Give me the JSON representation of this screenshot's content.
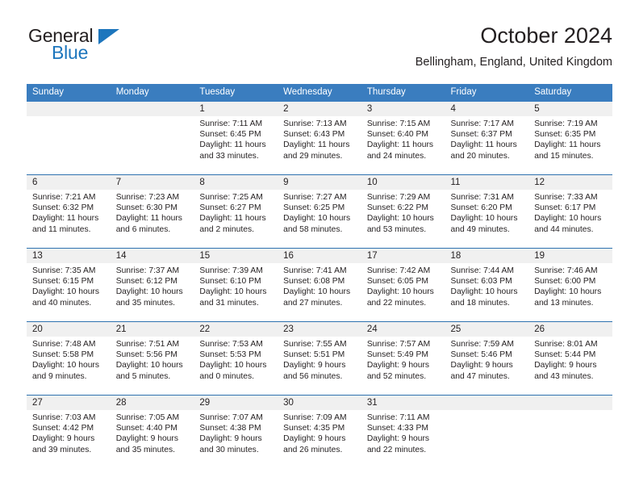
{
  "brand": {
    "name_part1": "General",
    "name_part2": "Blue",
    "colors": {
      "dark": "#231f20",
      "blue": "#1d76bd"
    }
  },
  "header": {
    "title": "October 2024",
    "subtitle": "Bellingham, England, United Kingdom"
  },
  "theme": {
    "header_row_bg": "#3a7dbf",
    "header_row_text": "#ffffff",
    "date_band_bg": "#f0f0f0",
    "row_separator": "#2f72b0",
    "cell_bg": "#ffffff",
    "text": "#231f20"
  },
  "weekday_headers": [
    "Sunday",
    "Monday",
    "Tuesday",
    "Wednesday",
    "Thursday",
    "Friday",
    "Saturday"
  ],
  "weeks": [
    [
      {
        "day": "",
        "empty": true
      },
      {
        "day": "",
        "empty": true
      },
      {
        "day": "1",
        "sunrise": "Sunrise: 7:11 AM",
        "sunset": "Sunset: 6:45 PM",
        "daylight_line1": "Daylight: 11 hours",
        "daylight_line2": "and 33 minutes."
      },
      {
        "day": "2",
        "sunrise": "Sunrise: 7:13 AM",
        "sunset": "Sunset: 6:43 PM",
        "daylight_line1": "Daylight: 11 hours",
        "daylight_line2": "and 29 minutes."
      },
      {
        "day": "3",
        "sunrise": "Sunrise: 7:15 AM",
        "sunset": "Sunset: 6:40 PM",
        "daylight_line1": "Daylight: 11 hours",
        "daylight_line2": "and 24 minutes."
      },
      {
        "day": "4",
        "sunrise": "Sunrise: 7:17 AM",
        "sunset": "Sunset: 6:37 PM",
        "daylight_line1": "Daylight: 11 hours",
        "daylight_line2": "and 20 minutes."
      },
      {
        "day": "5",
        "sunrise": "Sunrise: 7:19 AM",
        "sunset": "Sunset: 6:35 PM",
        "daylight_line1": "Daylight: 11 hours",
        "daylight_line2": "and 15 minutes."
      }
    ],
    [
      {
        "day": "6",
        "sunrise": "Sunrise: 7:21 AM",
        "sunset": "Sunset: 6:32 PM",
        "daylight_line1": "Daylight: 11 hours",
        "daylight_line2": "and 11 minutes."
      },
      {
        "day": "7",
        "sunrise": "Sunrise: 7:23 AM",
        "sunset": "Sunset: 6:30 PM",
        "daylight_line1": "Daylight: 11 hours",
        "daylight_line2": "and 6 minutes."
      },
      {
        "day": "8",
        "sunrise": "Sunrise: 7:25 AM",
        "sunset": "Sunset: 6:27 PM",
        "daylight_line1": "Daylight: 11 hours",
        "daylight_line2": "and 2 minutes."
      },
      {
        "day": "9",
        "sunrise": "Sunrise: 7:27 AM",
        "sunset": "Sunset: 6:25 PM",
        "daylight_line1": "Daylight: 10 hours",
        "daylight_line2": "and 58 minutes."
      },
      {
        "day": "10",
        "sunrise": "Sunrise: 7:29 AM",
        "sunset": "Sunset: 6:22 PM",
        "daylight_line1": "Daylight: 10 hours",
        "daylight_line2": "and 53 minutes."
      },
      {
        "day": "11",
        "sunrise": "Sunrise: 7:31 AM",
        "sunset": "Sunset: 6:20 PM",
        "daylight_line1": "Daylight: 10 hours",
        "daylight_line2": "and 49 minutes."
      },
      {
        "day": "12",
        "sunrise": "Sunrise: 7:33 AM",
        "sunset": "Sunset: 6:17 PM",
        "daylight_line1": "Daylight: 10 hours",
        "daylight_line2": "and 44 minutes."
      }
    ],
    [
      {
        "day": "13",
        "sunrise": "Sunrise: 7:35 AM",
        "sunset": "Sunset: 6:15 PM",
        "daylight_line1": "Daylight: 10 hours",
        "daylight_line2": "and 40 minutes."
      },
      {
        "day": "14",
        "sunrise": "Sunrise: 7:37 AM",
        "sunset": "Sunset: 6:12 PM",
        "daylight_line1": "Daylight: 10 hours",
        "daylight_line2": "and 35 minutes."
      },
      {
        "day": "15",
        "sunrise": "Sunrise: 7:39 AM",
        "sunset": "Sunset: 6:10 PM",
        "daylight_line1": "Daylight: 10 hours",
        "daylight_line2": "and 31 minutes."
      },
      {
        "day": "16",
        "sunrise": "Sunrise: 7:41 AM",
        "sunset": "Sunset: 6:08 PM",
        "daylight_line1": "Daylight: 10 hours",
        "daylight_line2": "and 27 minutes."
      },
      {
        "day": "17",
        "sunrise": "Sunrise: 7:42 AM",
        "sunset": "Sunset: 6:05 PM",
        "daylight_line1": "Daylight: 10 hours",
        "daylight_line2": "and 22 minutes."
      },
      {
        "day": "18",
        "sunrise": "Sunrise: 7:44 AM",
        "sunset": "Sunset: 6:03 PM",
        "daylight_line1": "Daylight: 10 hours",
        "daylight_line2": "and 18 minutes."
      },
      {
        "day": "19",
        "sunrise": "Sunrise: 7:46 AM",
        "sunset": "Sunset: 6:00 PM",
        "daylight_line1": "Daylight: 10 hours",
        "daylight_line2": "and 13 minutes."
      }
    ],
    [
      {
        "day": "20",
        "sunrise": "Sunrise: 7:48 AM",
        "sunset": "Sunset: 5:58 PM",
        "daylight_line1": "Daylight: 10 hours",
        "daylight_line2": "and 9 minutes."
      },
      {
        "day": "21",
        "sunrise": "Sunrise: 7:51 AM",
        "sunset": "Sunset: 5:56 PM",
        "daylight_line1": "Daylight: 10 hours",
        "daylight_line2": "and 5 minutes."
      },
      {
        "day": "22",
        "sunrise": "Sunrise: 7:53 AM",
        "sunset": "Sunset: 5:53 PM",
        "daylight_line1": "Daylight: 10 hours",
        "daylight_line2": "and 0 minutes."
      },
      {
        "day": "23",
        "sunrise": "Sunrise: 7:55 AM",
        "sunset": "Sunset: 5:51 PM",
        "daylight_line1": "Daylight: 9 hours",
        "daylight_line2": "and 56 minutes."
      },
      {
        "day": "24",
        "sunrise": "Sunrise: 7:57 AM",
        "sunset": "Sunset: 5:49 PM",
        "daylight_line1": "Daylight: 9 hours",
        "daylight_line2": "and 52 minutes."
      },
      {
        "day": "25",
        "sunrise": "Sunrise: 7:59 AM",
        "sunset": "Sunset: 5:46 PM",
        "daylight_line1": "Daylight: 9 hours",
        "daylight_line2": "and 47 minutes."
      },
      {
        "day": "26",
        "sunrise": "Sunrise: 8:01 AM",
        "sunset": "Sunset: 5:44 PM",
        "daylight_line1": "Daylight: 9 hours",
        "daylight_line2": "and 43 minutes."
      }
    ],
    [
      {
        "day": "27",
        "sunrise": "Sunrise: 7:03 AM",
        "sunset": "Sunset: 4:42 PM",
        "daylight_line1": "Daylight: 9 hours",
        "daylight_line2": "and 39 minutes."
      },
      {
        "day": "28",
        "sunrise": "Sunrise: 7:05 AM",
        "sunset": "Sunset: 4:40 PM",
        "daylight_line1": "Daylight: 9 hours",
        "daylight_line2": "and 35 minutes."
      },
      {
        "day": "29",
        "sunrise": "Sunrise: 7:07 AM",
        "sunset": "Sunset: 4:38 PM",
        "daylight_line1": "Daylight: 9 hours",
        "daylight_line2": "and 30 minutes."
      },
      {
        "day": "30",
        "sunrise": "Sunrise: 7:09 AM",
        "sunset": "Sunset: 4:35 PM",
        "daylight_line1": "Daylight: 9 hours",
        "daylight_line2": "and 26 minutes."
      },
      {
        "day": "31",
        "sunrise": "Sunrise: 7:11 AM",
        "sunset": "Sunset: 4:33 PM",
        "daylight_line1": "Daylight: 9 hours",
        "daylight_line2": "and 22 minutes."
      },
      {
        "day": "",
        "empty": true
      },
      {
        "day": "",
        "empty": true
      }
    ]
  ]
}
